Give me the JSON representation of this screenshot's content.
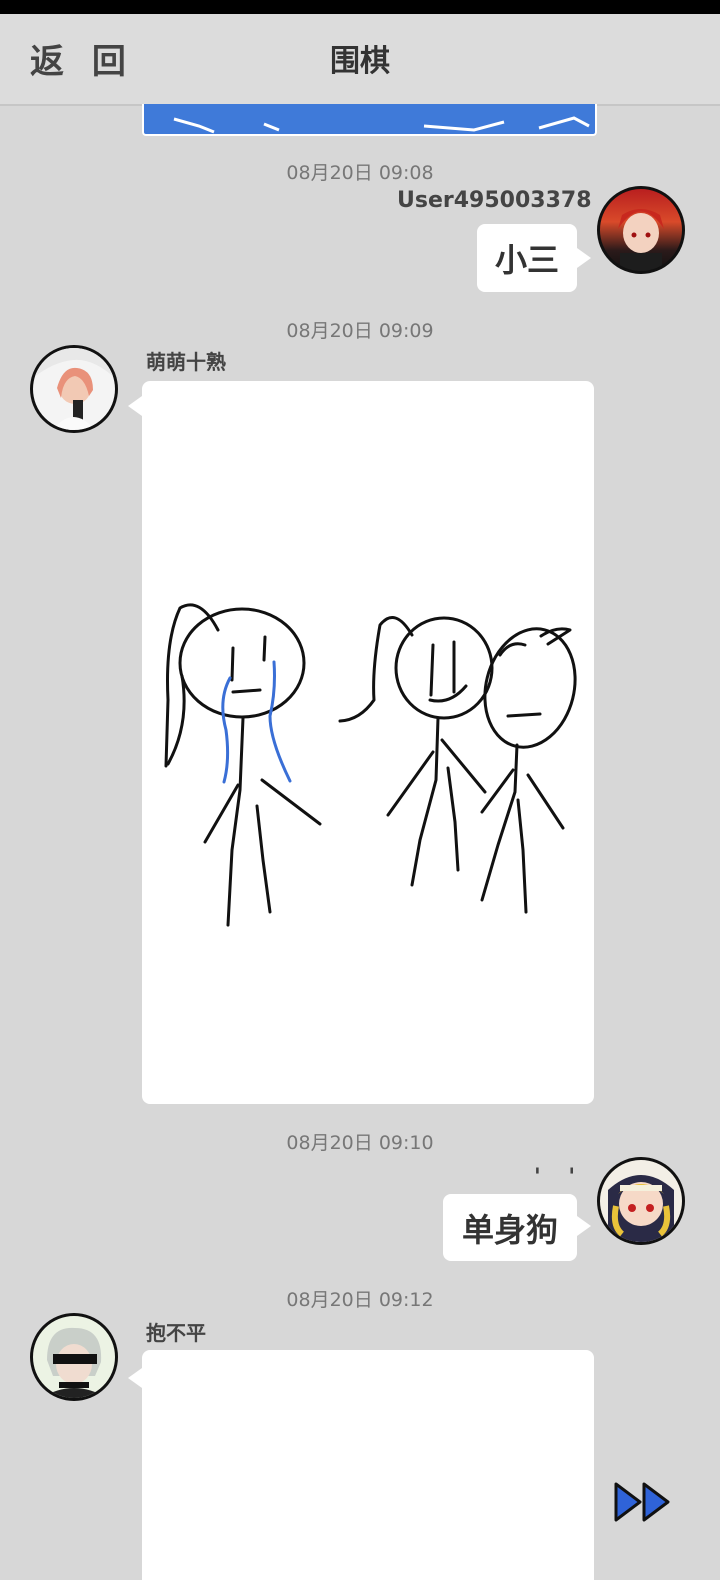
{
  "header": {
    "back_label": "返 回",
    "title": "围棋"
  },
  "messages": [
    {
      "time": "08月20日  09:08",
      "user": "User495003378",
      "text": "小三"
    },
    {
      "time": "08月20日  09:09",
      "user": "萌萌十熟",
      "content": "stick-figure-drawing"
    },
    {
      "time": "08月20日  09:10",
      "user": "' '",
      "text": "单身狗"
    },
    {
      "time": "08月20日  09:12",
      "user": "抱不平",
      "content": "drawing-image"
    }
  ],
  "icons": {
    "skip": "double-play-icon"
  },
  "colors": {
    "background": "#d7d7d7",
    "accent": "#2f63d8",
    "tear": "#3a6fd6"
  }
}
